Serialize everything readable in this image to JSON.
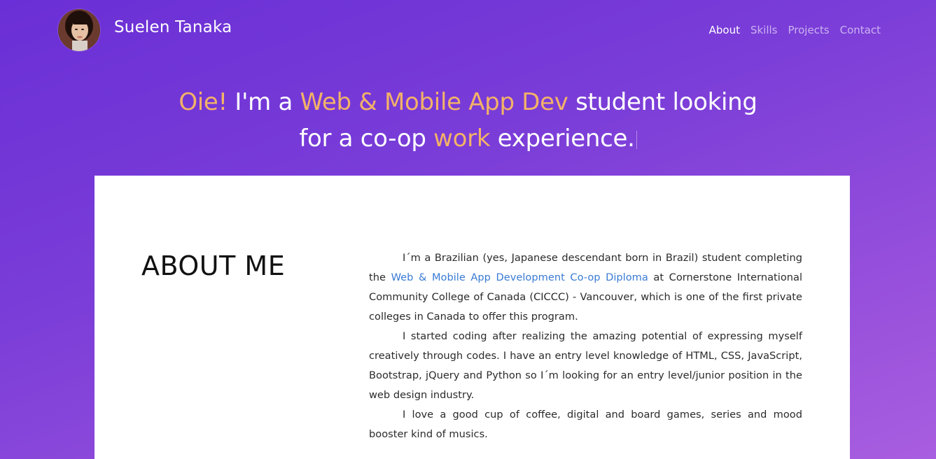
{
  "header": {
    "name": "Suelen Tanaka",
    "nav": [
      {
        "label": "About",
        "active": true
      },
      {
        "label": "Skills",
        "active": false
      },
      {
        "label": "Projects",
        "active": false
      },
      {
        "label": "Contact",
        "active": false
      }
    ]
  },
  "hero": {
    "part1": "Oie!",
    "part2": " I'm a ",
    "part3": "Web & Mobile App Dev",
    "part4": " student looking",
    "part5": "for a co-op ",
    "part6": "work",
    "part7": " experience."
  },
  "about": {
    "heading": "ABOUT ME",
    "p1_before": "I´m a Brazilian (yes, Japanese descendant born in Brazil) student completing the ",
    "p1_link": "Web & Mobile App Development Co-op Diploma",
    "p1_after": " at Cornerstone International Community College of Canada (CICCC) - Vancouver, which is one of the first private colleges in Canada to offer this program.",
    "p2": "I started coding after realizing the amazing potential of expressing myself creatively through codes. I have an entry level knowledge of HTML, CSS, JavaScript, Bootstrap, jQuery and Python so I´m looking for an entry level/junior position in the web design industry.",
    "p3": "I love a good cup of coffee, digital and board games, series and mood booster kind of musics."
  },
  "colors": {
    "accent": "#f3b268",
    "link": "#3a7bd5",
    "gradient_start": "#6a2fd6",
    "gradient_end": "#a95ee0"
  }
}
